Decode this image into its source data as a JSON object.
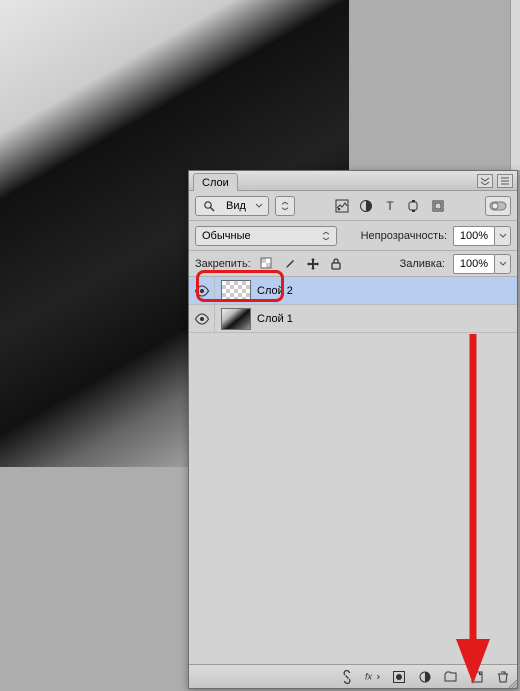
{
  "panel": {
    "title": "Слои",
    "search_label": "Вид",
    "blend_mode": "Обычные",
    "opacity_label": "Непрозрачность:",
    "opacity_value": "100%",
    "lock_label": "Закрепить:",
    "fill_label": "Заливка:",
    "fill_value": "100%"
  },
  "filterIcons": [
    "pixel-filter-icon",
    "adjust-filter-icon",
    "type-filter-icon",
    "shape-filter-icon",
    "smart-filter-icon"
  ],
  "lockIcons": [
    "lock-transparency-icon",
    "lock-brush-icon",
    "lock-move-icon",
    "lock-all-icon"
  ],
  "layers": [
    {
      "name": "Слой 2",
      "thumb": "checker",
      "selected": true
    },
    {
      "name": "Слой 1",
      "thumb": "photo",
      "selected": false
    }
  ],
  "footerIcons": [
    "link-layers-icon",
    "fx-icon",
    "mask-icon",
    "adjustment-icon",
    "group-icon",
    "new-layer-icon",
    "trash-icon"
  ]
}
